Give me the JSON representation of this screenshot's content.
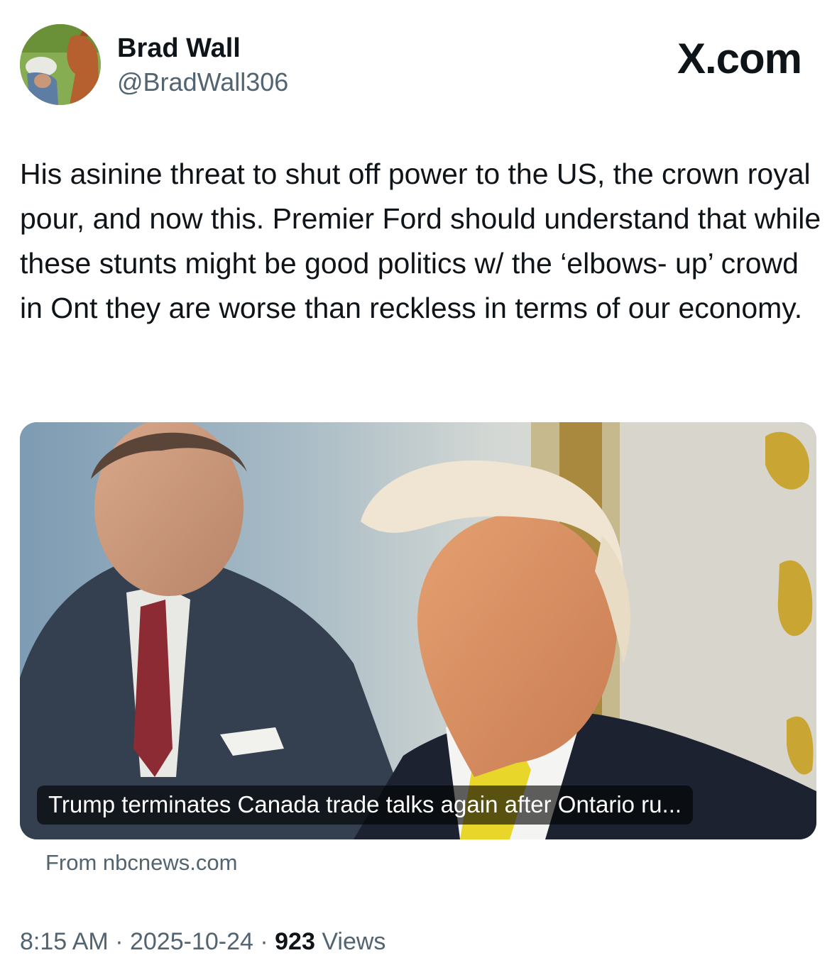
{
  "author": {
    "name": "Brad Wall",
    "handle": "@BradWall306"
  },
  "brand": "X.com",
  "tweet": {
    "text": "His asinine threat to shut off power to the US, the crown royal pour, and now this. Premier Ford should understand that while these stunts might be good politics w/ the ‘elbows- up’ crowd in Ont they are worse than reckless in terms of our economy."
  },
  "card": {
    "headline": "Trump terminates Canada trade talks again after Ontario ru...",
    "source": "From nbcnews.com"
  },
  "meta": {
    "time": "8:15 AM",
    "separator": "·",
    "date": "2025-10-24",
    "views_count": "923",
    "views_label": "Views"
  }
}
